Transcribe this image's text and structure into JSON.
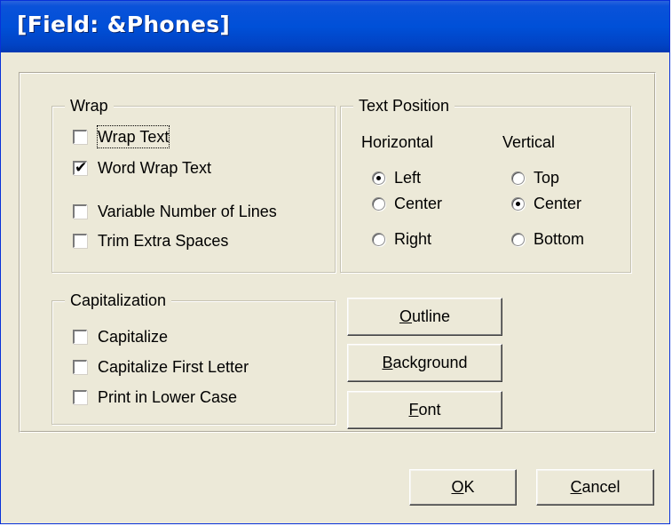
{
  "window": {
    "title": "[Field: &Phones]"
  },
  "wrap_group": {
    "legend": "Wrap",
    "options": [
      {
        "label": "Wrap Text",
        "checked": false
      },
      {
        "label": "Word Wrap Text",
        "checked": true
      },
      {
        "label": "Variable Number of Lines",
        "checked": false
      },
      {
        "label": "Trim Extra Spaces",
        "checked": false
      }
    ]
  },
  "text_position_group": {
    "legend": "Text Position",
    "horizontal": {
      "label": "Horizontal",
      "options": [
        {
          "label": "Left",
          "selected": true
        },
        {
          "label": "Center",
          "selected": false
        },
        {
          "label": "Right",
          "selected": false
        }
      ]
    },
    "vertical": {
      "label": "Vertical",
      "options": [
        {
          "label": "Top",
          "selected": false
        },
        {
          "label": "Center",
          "selected": true
        },
        {
          "label": "Bottom",
          "selected": false
        }
      ]
    }
  },
  "capitalization_group": {
    "legend": "Capitalization",
    "options": [
      {
        "label": "Capitalize",
        "checked": false
      },
      {
        "label": "Capitalize First Letter",
        "checked": false
      },
      {
        "label": "Print in Lower Case",
        "checked": false
      }
    ]
  },
  "buttons": {
    "outline": {
      "accel": "O",
      "rest": "utline"
    },
    "background": {
      "accel": "B",
      "rest": "ackground"
    },
    "font": {
      "accel": "F",
      "rest": "ont"
    },
    "ok": {
      "accel": "O",
      "rest": "K"
    },
    "cancel": {
      "accel": "C",
      "rest": "ancel"
    }
  }
}
